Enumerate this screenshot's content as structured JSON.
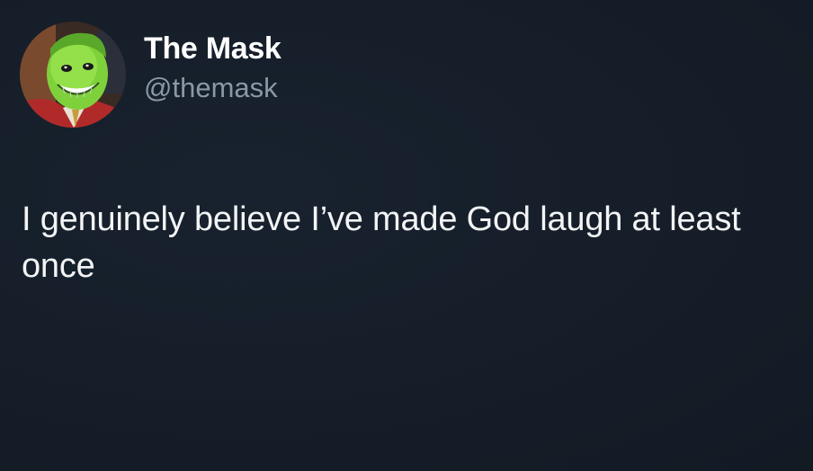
{
  "tweet": {
    "author": {
      "display_name": "The Mask",
      "handle": "@themask",
      "avatar_icon": "green-mask-face-avatar"
    },
    "text": "I genuinely believe I’ve made God laugh at least once"
  },
  "colors": {
    "background": "#15202b",
    "text_primary": "#ffffff",
    "text_secondary": "#8b98a5",
    "avatar_face": "#7fd13b"
  }
}
